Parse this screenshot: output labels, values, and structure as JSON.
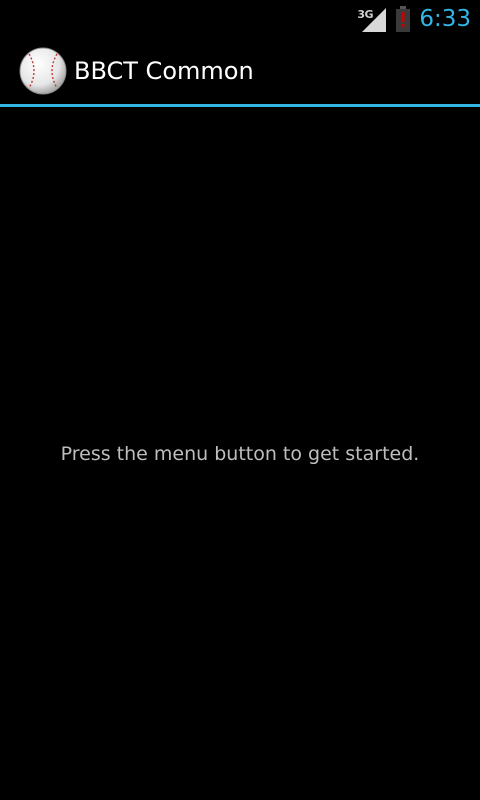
{
  "status_bar": {
    "network_type": "3G",
    "time": "6:33",
    "accent_color": "#33b5e5",
    "battery_alert_color": "#cc0000"
  },
  "action_bar": {
    "app_icon": "baseball-icon",
    "title": "BBCT Common",
    "divider_color": "#33b5e5"
  },
  "main": {
    "hint": "Press the menu button to get started."
  }
}
